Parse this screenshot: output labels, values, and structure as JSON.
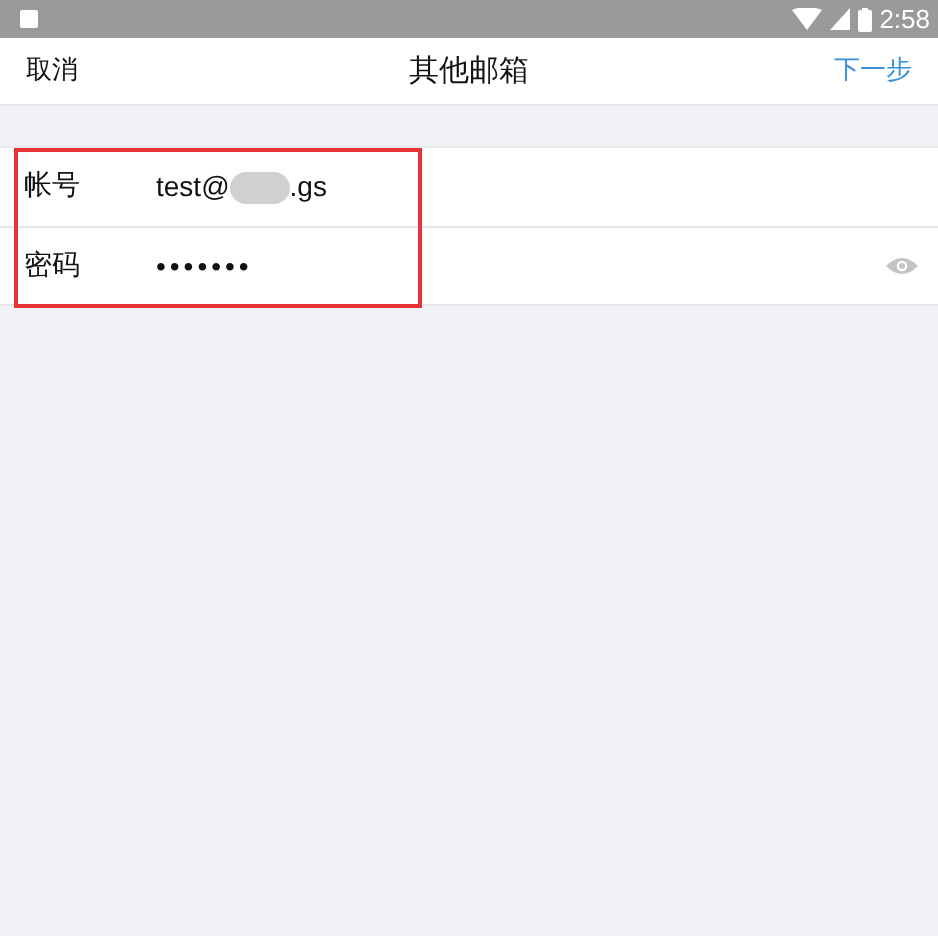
{
  "status_bar": {
    "time": "2:58"
  },
  "nav": {
    "cancel": "取消",
    "title": "其他邮箱",
    "next": "下一步"
  },
  "fields": [
    {
      "kind": "account",
      "label": "帐号",
      "value_start": "test@",
      "redacted": true,
      "value_end": ".gs"
    },
    {
      "kind": "password",
      "label": "密码",
      "value": "•••••••",
      "reveal_icon": true
    }
  ],
  "highlight": true
}
